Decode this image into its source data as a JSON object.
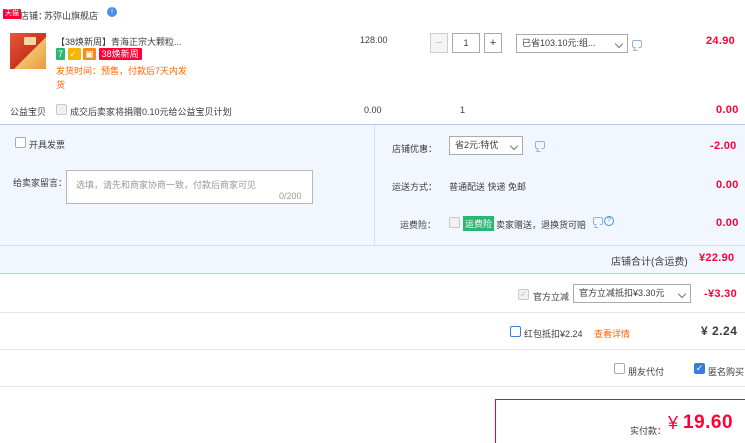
{
  "shop": {
    "tag": "天猫",
    "label": "店铺：",
    "name": "苏弥山旗舰店",
    "service_badge": "i"
  },
  "item": {
    "title": "【38焕新周】青海正宗大颗粒...",
    "badge_seven": "7",
    "badge_event": "38焕新周",
    "ship_time": "发货时间：预售，付款后7天内发货",
    "price": "128.00",
    "qty": "1",
    "qty_minus": "−",
    "qty_plus": "+",
    "discount_select": "已省103.10元:组...",
    "subtotal": "24.90"
  },
  "charity": {
    "label": "公益宝贝",
    "text": "成交后卖家将捐赠0.10元给公益宝贝计划",
    "price": "0.00",
    "qty": "1",
    "subtotal": "0.00"
  },
  "invoice": {
    "label": "开具发票"
  },
  "message": {
    "label": "给卖家留言：",
    "placeholder": "选填，请先和商家协商一致，付款后商家可见",
    "counter": "0/200"
  },
  "shop_discount": {
    "label": "店铺优惠：",
    "select": "省2元:特优",
    "amount": "-2.00"
  },
  "delivery": {
    "label": "运送方式：",
    "text": "普通配送 快递 免邮",
    "amount": "0.00"
  },
  "insurance": {
    "label": "运费险：",
    "badge": "运费险",
    "text": "卖家赠送，退换货可赔",
    "help": "?",
    "amount": "0.00"
  },
  "shop_total": {
    "label": "店铺合计(含运费)",
    "amount": "¥22.90"
  },
  "official_discount": {
    "label": "官方立减",
    "select": "官方立减抵扣¥3.30元",
    "amount": "-¥3.30"
  },
  "red_packet": {
    "label": "红包抵扣¥2.24",
    "link": "查看详情",
    "amount": "¥ 2.24"
  },
  "options": {
    "friend_pay": "朋友代付",
    "anonymous": "匿名购买",
    "check": "✓"
  },
  "pay": {
    "label": "实付款：",
    "currency": "¥",
    "amount": "19.60"
  },
  "colors": {
    "accent_red": "#ff0036",
    "panel_blue": "#f2f7ff",
    "border_blue": "#b8cdea"
  }
}
